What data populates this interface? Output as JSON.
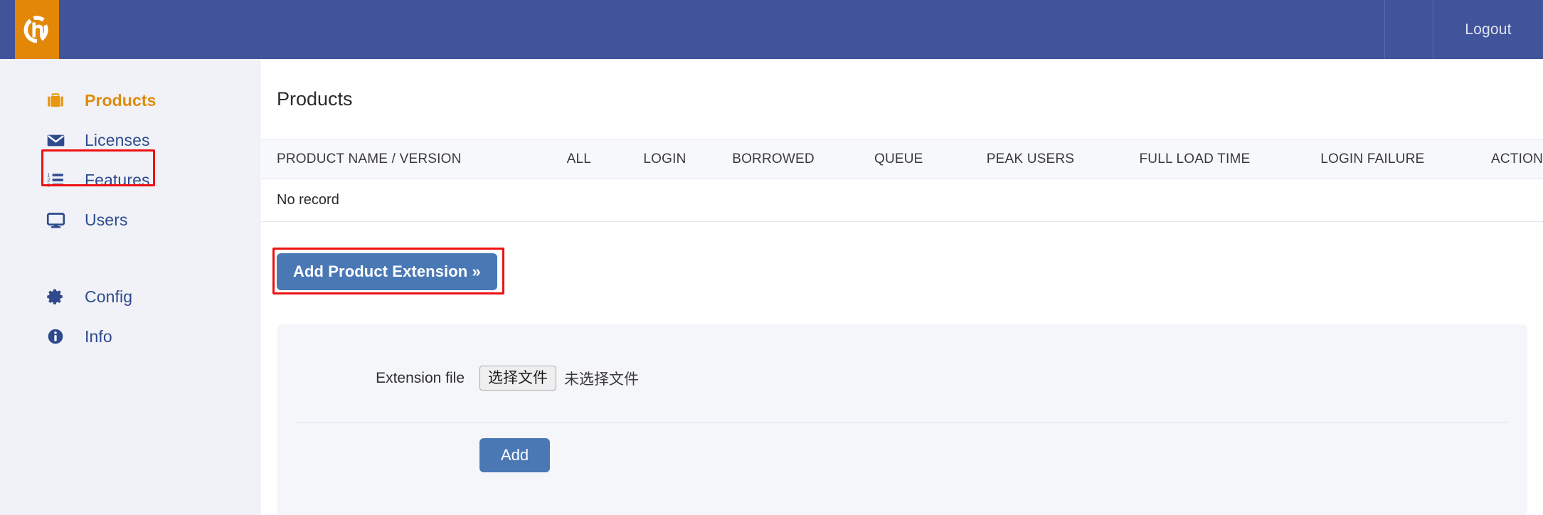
{
  "topbar": {
    "logo_icon": "brand-logo-icon",
    "logout_label": "Logout"
  },
  "sidebar": {
    "items": [
      {
        "label": "Products",
        "icon": "briefcase-icon",
        "active": true
      },
      {
        "label": "Licenses",
        "icon": "envelope-icon",
        "active": false
      },
      {
        "label": "Features",
        "icon": "numbered-list-icon",
        "active": false
      },
      {
        "label": "Users",
        "icon": "monitor-icon",
        "active": false
      },
      {
        "label": "Config",
        "icon": "gear-icon",
        "active": false
      },
      {
        "label": "Info",
        "icon": "info-circle-icon",
        "active": false
      }
    ]
  },
  "main": {
    "page_title": "Products",
    "table": {
      "headers": [
        "PRODUCT NAME / VERSION",
        "ALL",
        "LOGIN",
        "BORROWED",
        "QUEUE",
        "PEAK USERS",
        "FULL LOAD TIME",
        "LOGIN FAILURE",
        "ACTION"
      ],
      "empty_text": "No record",
      "rows": []
    },
    "add_extension_button": "Add Product Extension »",
    "form": {
      "file_label": "Extension file",
      "file_choose_button": "选择文件",
      "file_status": "未选择文件",
      "submit_label": "Add"
    }
  },
  "colors": {
    "header_blue": "#41549b",
    "logo_orange": "#e38709",
    "accent_orange": "#e08a0b",
    "nav_blue": "#2f4a8c",
    "button_blue": "#4a78b5",
    "highlight_red": "#ee1111",
    "sidebar_bg": "#f0f2f7",
    "panel_bg": "#f5f6fa"
  }
}
